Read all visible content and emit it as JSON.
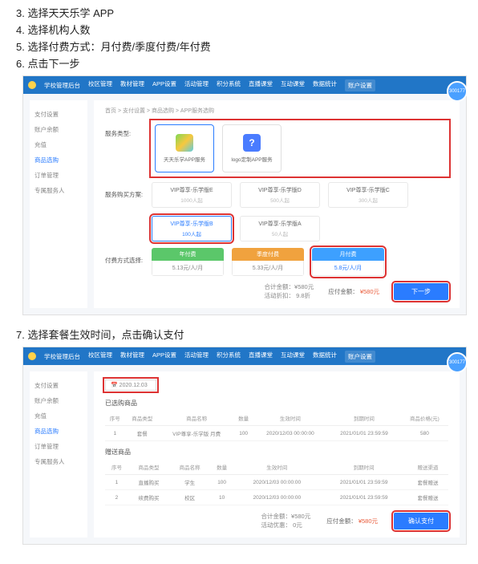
{
  "instructions": {
    "i3": "3.  选择天天乐学 APP",
    "i4": "4.  选择机构人数",
    "i5": "5.  选择付费方式：月付费/季度付费/年付费",
    "i6": "6.  点击下一步",
    "i7": "7.  选择套餐生效时间，点击确认支付"
  },
  "topbar": {
    "brand": "学校管理后台",
    "navs": [
      "校区管理",
      "教材管理",
      "APP设置",
      "活动管理",
      "积分系统",
      "直播课堂",
      "互动课堂",
      "数据统计",
      "账户设置"
    ],
    "avatar_id": "300177"
  },
  "side": {
    "items": [
      "支付设置",
      "账户余额",
      "充值",
      "商品选购",
      "订单管理",
      "专属服务人"
    ],
    "active": "商品选购"
  },
  "screen1": {
    "crumb": "首页 > 支付设置 > 商品选购 > APP服务选购",
    "row1_label": "服务类型:",
    "svc1": "天天乐学APP服务",
    "svc2": "logo定制APP服务",
    "row2_label": "服务购买方案:",
    "plans": [
      {
        "name": "VIP尊享-乐学版E",
        "sub": "1000人起"
      },
      {
        "name": "VIP尊享-乐学版D",
        "sub": "500人起"
      },
      {
        "name": "VIP尊享-乐学版C",
        "sub": "300人起"
      },
      {
        "name": "VIP尊享-乐学版B",
        "sub": "100人起"
      },
      {
        "name": "VIP尊享-乐学版A",
        "sub": "50人起"
      }
    ],
    "row3_label": "付费方式选择:",
    "pays": [
      {
        "hd": "年付费",
        "bd": "5.13元/人/月"
      },
      {
        "hd": "季度付费",
        "bd": "5.33元/人/月"
      },
      {
        "hd": "月付费",
        "bd": "5.8元/人/月"
      }
    ],
    "total_calc1": "合计金额：¥580元",
    "total_calc2": "活动折扣：   9.8折",
    "total_pay_label": "应付金额：",
    "total_pay_value": "¥580元",
    "next": "下一步"
  },
  "screen2": {
    "date": "2020.12.03",
    "sec1": "已选购商品",
    "thead1": [
      "序号",
      "商品类型",
      "商品名称",
      "数量",
      "生效时间",
      "到期时间",
      "商品价格(元)"
    ],
    "row1": [
      "1",
      "套餐",
      "VIP尊享-乐学版 月费",
      "100",
      "2020/12/03 00:00:00",
      "2021/01/01 23:59:59",
      "580"
    ],
    "sec2": "赠送商品",
    "thead2": [
      "序号",
      "商品类型",
      "商品名称",
      "数量",
      "生效时间",
      "到期时间",
      "赠送渠道"
    ],
    "rows2": [
      [
        "1",
        "直播购买",
        "学生",
        "100",
        "2020/12/03 00:00:00",
        "2021/01/01 23:59:59",
        "套餐赠送"
      ],
      [
        "2",
        "续费购买",
        "校区",
        "10",
        "2020/12/03 00:00:00",
        "2021/01/01 23:59:59",
        "套餐赠送"
      ]
    ],
    "foot_calc1": "合计金额：¥580元",
    "foot_calc2": "活动优惠：  0元",
    "foot_pay_label": "应付金额：",
    "foot_pay_value": "¥580元",
    "confirm": "确认支付"
  }
}
